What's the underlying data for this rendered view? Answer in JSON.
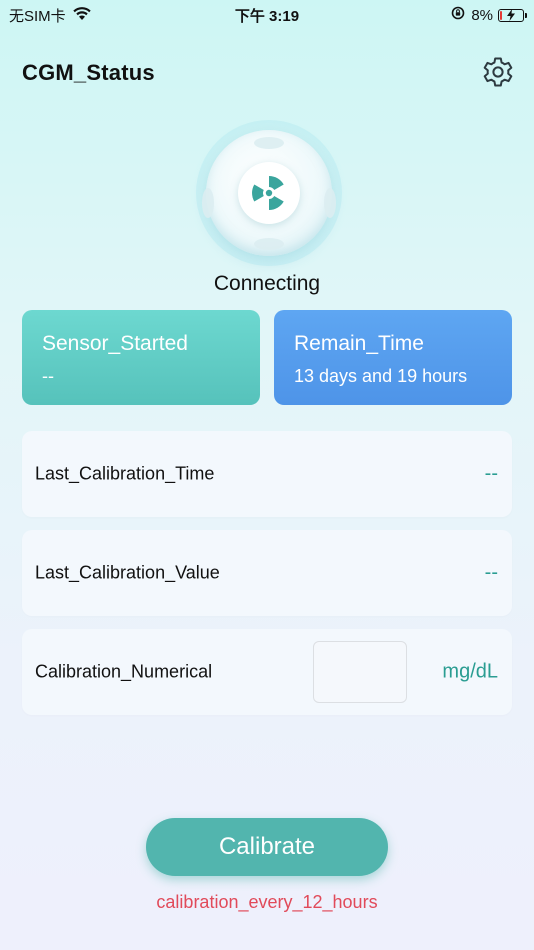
{
  "status_bar": {
    "carrier": "无SIM卡",
    "time": "下午 3:19",
    "battery_percent": "8%",
    "battery_level": 0.08,
    "battery_color": "#e53935"
  },
  "header": {
    "title": "CGM_Status",
    "settings_icon": "gear-icon"
  },
  "sensor": {
    "icon": "sensor-fan-icon",
    "status": "Connecting"
  },
  "cards": {
    "sensor_started": {
      "title": "Sensor_Started",
      "value": "--"
    },
    "remain_time": {
      "title": "Remain_Time",
      "value": "13 days and 19 hours"
    }
  },
  "rows": {
    "last_calibration_time": {
      "label": "Last_Calibration_Time",
      "value": "--"
    },
    "last_calibration_value": {
      "label": "Last_Calibration_Value",
      "value": "--"
    },
    "calibration_numerical": {
      "label": "Calibration_Numerical",
      "input_value": "",
      "unit": "mg/dL"
    }
  },
  "actions": {
    "calibrate_label": "Calibrate",
    "hint": "calibration_every_12_hours"
  },
  "colors": {
    "accent_teal": "#52b5ae",
    "card_teal": "#5fcdc5",
    "card_blue": "#549deb",
    "hint_red": "#e14a5a"
  }
}
